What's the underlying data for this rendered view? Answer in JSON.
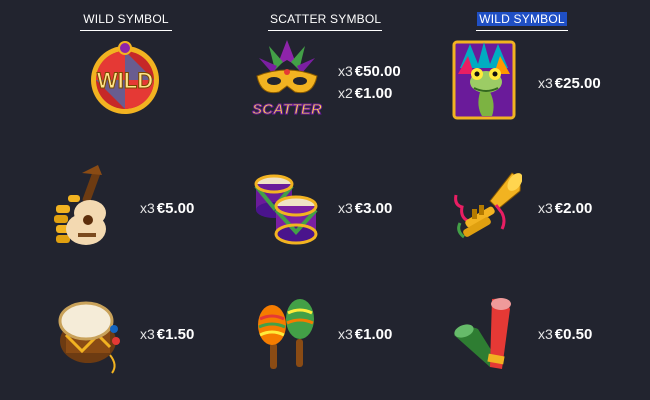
{
  "headers": [
    {
      "label": "WILD SYMBOL",
      "selected": false
    },
    {
      "label": "SCATTER SYMBOL",
      "selected": false
    },
    {
      "label": "WILD SYMBOL",
      "selected": true
    }
  ],
  "symbols": {
    "wild_medallion": {
      "icon": "wild-medallion-icon",
      "text": "WILD"
    },
    "scatter_mask": {
      "icon": "carnival-mask-scatter-icon",
      "text": "SCATTER",
      "pays": [
        {
          "mult": "x3",
          "amount": "€50.00"
        },
        {
          "mult": "x2",
          "amount": "€1.00"
        }
      ]
    },
    "frog": {
      "icon": "frog-wild-icon",
      "pays": [
        {
          "mult": "x3",
          "amount": "€25.00"
        }
      ]
    },
    "guitar": {
      "icon": "guitar-icon",
      "pays": [
        {
          "mult": "x3",
          "amount": "€5.00"
        }
      ]
    },
    "drums": {
      "icon": "drums-icon",
      "pays": [
        {
          "mult": "x3",
          "amount": "€3.00"
        }
      ]
    },
    "trumpet": {
      "icon": "trumpet-icon",
      "pays": [
        {
          "mult": "x3",
          "amount": "€2.00"
        }
      ]
    },
    "tambourine": {
      "icon": "tambourine-drum-icon",
      "pays": [
        {
          "mult": "x3",
          "amount": "€1.50"
        }
      ]
    },
    "maracas": {
      "icon": "maracas-icon",
      "pays": [
        {
          "mult": "x3",
          "amount": "€1.00"
        }
      ]
    },
    "horns": {
      "icon": "party-horns-icon",
      "pays": [
        {
          "mult": "x3",
          "amount": "€0.50"
        }
      ]
    }
  },
  "colors": {
    "background": "#22242f",
    "selection": "#1f4fc4",
    "gold": "#f2b321"
  }
}
